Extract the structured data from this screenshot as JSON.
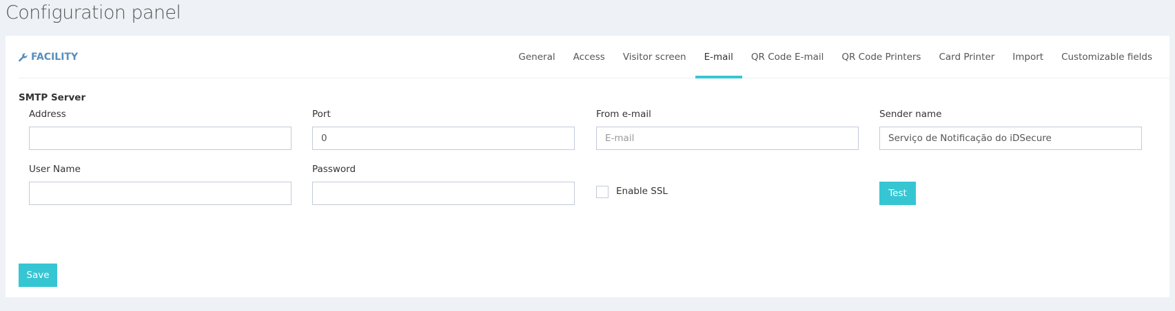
{
  "page_title": "Configuration panel",
  "panel": {
    "caption": "FACILITY",
    "caption_icon": "wrench-icon",
    "accent_color": "#36c6d3",
    "caption_color": "#578ebe"
  },
  "tabs": [
    {
      "label": "General",
      "active": false
    },
    {
      "label": "Access",
      "active": false
    },
    {
      "label": "Visitor screen",
      "active": false
    },
    {
      "label": "E-mail",
      "active": true
    },
    {
      "label": "QR Code E-mail",
      "active": false
    },
    {
      "label": "QR Code Printers",
      "active": false
    },
    {
      "label": "Card Printer",
      "active": false
    },
    {
      "label": "Import",
      "active": false
    },
    {
      "label": "Customizable fields",
      "active": false
    }
  ],
  "smtp": {
    "section_title": "SMTP Server",
    "address": {
      "label": "Address",
      "value": "",
      "placeholder": ""
    },
    "port": {
      "label": "Port",
      "value": "0",
      "placeholder": ""
    },
    "from_email": {
      "label": "From e-mail",
      "value": "",
      "placeholder": "E-mail"
    },
    "sender_name": {
      "label": "Sender name",
      "value": "Serviço de Notificação do iDSecure",
      "placeholder": ""
    },
    "user_name": {
      "label": "User Name",
      "value": "",
      "placeholder": ""
    },
    "password": {
      "label": "Password",
      "value": "",
      "placeholder": ""
    },
    "enable_ssl": {
      "label": "Enable SSL",
      "checked": false
    },
    "test_button": "Test"
  },
  "save_button": "Save"
}
